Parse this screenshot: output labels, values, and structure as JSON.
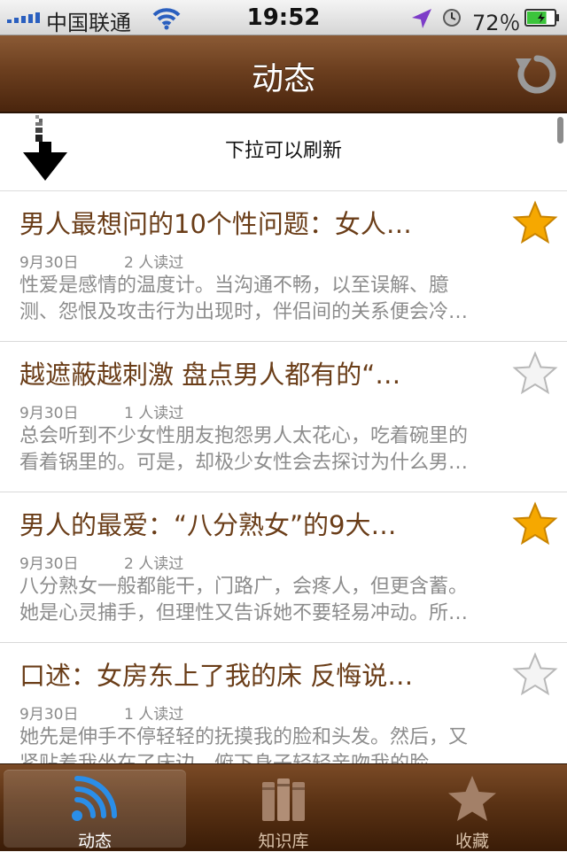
{
  "status_bar": {
    "carrier": "中国联通",
    "time": "19:52",
    "battery_percent": "72％",
    "battery_level": 0.72
  },
  "nav": {
    "title": "动态"
  },
  "pull_refresh": {
    "text": "下拉可以刷新"
  },
  "articles": [
    {
      "title": "男人最想问的10个性问题：女人…",
      "date": "9月30日",
      "reads": "2 人读过",
      "summary_lines": [
        "性爱是感情的温度计。当沟通不畅，以至误解、臆",
        "测、怨恨及攻击行为出现时，伴侣间的关系便会冷…"
      ],
      "starred": true
    },
    {
      "title": "越遮蔽越刺激 盘点男人都有的“…",
      "date": "9月30日",
      "reads": "1 人读过",
      "summary_lines": [
        "总会听到不少女性朋友抱怨男人太花心，吃着碗里的",
        "看着锅里的。可是，却极少女性会去探讨为什么男…"
      ],
      "starred": false
    },
    {
      "title": "男人的最爱：“八分熟女”的9大…",
      "date": "9月30日",
      "reads": "2 人读过",
      "summary_lines": [
        "八分熟女一般都能干，门路广，会疼人，但更含蓄。",
        "她是心灵捕手，但理性又告诉她不要轻易冲动。所…"
      ],
      "starred": true
    },
    {
      "title": "口述：女房东上了我的床 反悔说…",
      "date": "9月30日",
      "reads": "1 人读过",
      "summary_lines": [
        "她先是伸手不停轻轻的抚摸我的脸和头发。然后，又",
        "紧贴着我坐在了床边，俯下身子轻轻亲吻我的脸"
      ],
      "starred": false
    }
  ],
  "tabs": [
    {
      "label": "动态",
      "icon": "rss-icon",
      "active": true
    },
    {
      "label": "知识库",
      "icon": "books-icon",
      "active": false
    },
    {
      "label": "收藏",
      "icon": "star-icon",
      "active": false
    }
  ],
  "colors": {
    "nav_brown": "#6c3f1f",
    "title_brown": "#6a3d18",
    "star_gold": "#f6a800",
    "rss_blue": "#2a8ee8"
  }
}
